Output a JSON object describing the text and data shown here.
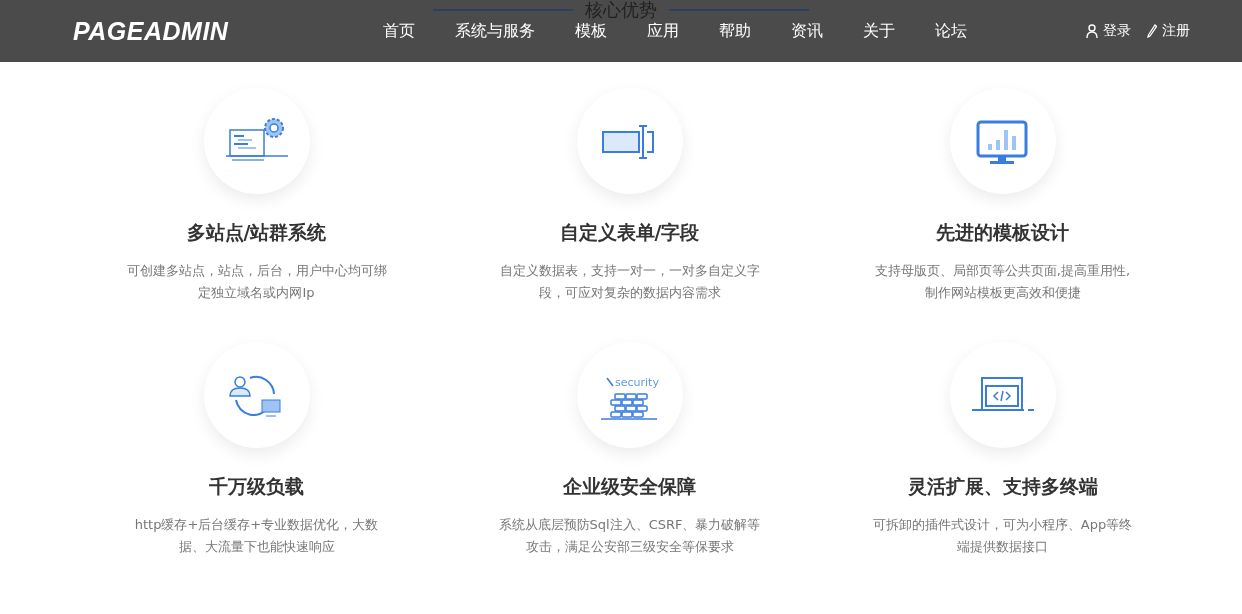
{
  "header": {
    "logo": "PAGEADMIN",
    "section_title": "核心优势",
    "nav": [
      {
        "label": "首页",
        "selected": false
      },
      {
        "label": "系统与服务",
        "selected": false
      },
      {
        "label": "模板",
        "selected": false
      },
      {
        "label": "应用",
        "selected": false
      },
      {
        "label": "帮助",
        "selected": false
      },
      {
        "label": "资讯",
        "selected": false
      },
      {
        "label": "关于",
        "selected": false
      },
      {
        "label": "论坛",
        "selected": false
      }
    ],
    "login": "登录",
    "register": "注册"
  },
  "features": [
    {
      "kind": "sites",
      "title": "多站点/站群系统",
      "description": "可创建多站点，站点，后台，用户中心均可绑定独立域名或内网Ip"
    },
    {
      "kind": "form",
      "title": "自定义表单/字段",
      "description": "自定义数据表，支持一对一，一对多自定义字段，可应对复杂的数据内容需求"
    },
    {
      "kind": "template",
      "title": "先进的模板设计",
      "description": "支持母版页、局部页等公共页面,提高重用性,制作网站模板更高效和便捷"
    },
    {
      "kind": "load",
      "title": "千万级负载",
      "description": "http缓存+后台缓存+专业数据优化，大数据、大流量下也能快速响应"
    },
    {
      "kind": "security",
      "title": "企业级安全保障",
      "description": "系统从底层预防Sql注入、CSRF、暴力破解等攻击，满足公安部三级安全等保要求",
      "icon_text": "security"
    },
    {
      "kind": "extend",
      "title": "灵活扩展、支持多终端",
      "description": "可拆卸的插件式设计，可为小程序、App等终端提供数据接口"
    }
  ]
}
